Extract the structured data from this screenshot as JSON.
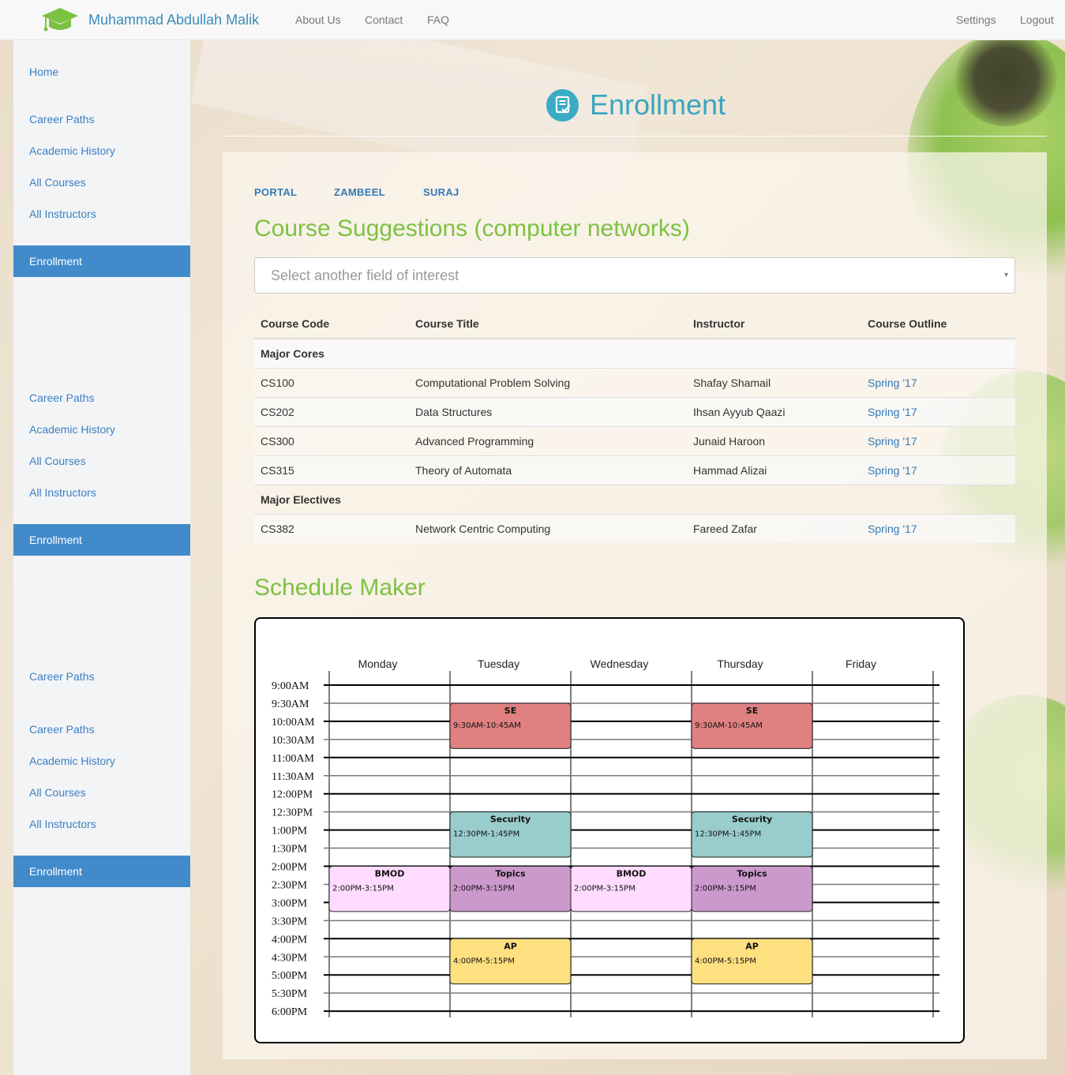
{
  "navbar": {
    "brand": "Muhammad Abdullah Malik",
    "links": [
      "About Us",
      "Contact",
      "FAQ"
    ],
    "right_links": [
      "Settings",
      "Logout"
    ]
  },
  "sidebar": {
    "home": "Home",
    "groups": [
      [
        "Career Paths",
        "Academic History",
        "All Courses",
        "All Instructors",
        "Enrollment"
      ],
      [
        "Career Paths",
        "Academic History",
        "All Courses",
        "All Instructors",
        "Enrollment"
      ],
      [
        "Career Paths"
      ],
      [
        "Career Paths",
        "Academic History",
        "All Courses",
        "All Instructors",
        "Enrollment"
      ]
    ]
  },
  "page": {
    "title": "Enrollment",
    "tabs": [
      "PORTAL",
      "ZAMBEEL",
      "SURAJ"
    ],
    "course_section_title": "Course Suggestions (computer networks)",
    "select_placeholder": "Select another field of interest",
    "schedule_title": "Schedule Maker"
  },
  "table": {
    "headers": [
      "Course Code",
      "Course Title",
      "Instructor",
      "Course Outline"
    ],
    "groups": [
      {
        "name": "Major Cores",
        "rows": [
          [
            "CS100",
            "Computational Problem Solving",
            "Shafay Shamail",
            "Spring '17"
          ],
          [
            "CS202",
            "Data Structures",
            "Ihsan Ayyub Qaazi",
            "Spring '17"
          ],
          [
            "CS300",
            "Advanced Programming",
            "Junaid Haroon",
            "Spring '17"
          ],
          [
            "CS315",
            "Theory of Automata",
            "Hammad Alizai",
            "Spring '17"
          ]
        ]
      },
      {
        "name": "Major Electives",
        "rows": [
          [
            "CS382",
            "Network Centric Computing",
            "Fareed Zafar",
            "Spring '17"
          ]
        ]
      }
    ]
  },
  "schedule": {
    "days": [
      "Monday",
      "Tuesday",
      "Wednesday",
      "Thursday",
      "Friday"
    ],
    "times": [
      "9:00AM",
      "9:30AM",
      "10:00AM",
      "10:30AM",
      "11:00AM",
      "11:30AM",
      "12:00PM",
      "12:30PM",
      "1:00PM",
      "1:30PM",
      "2:00PM",
      "2:30PM",
      "3:00PM",
      "3:30PM",
      "4:00PM",
      "4:30PM",
      "5:00PM",
      "5:30PM",
      "6:00PM"
    ],
    "events": [
      {
        "day": 1,
        "start": 1,
        "end": 3.5,
        "name": "SE",
        "time": "9:30AM-10:45AM",
        "color": "#e08080"
      },
      {
        "day": 3,
        "start": 1,
        "end": 3.5,
        "name": "SE",
        "time": "9:30AM-10:45AM",
        "color": "#e08080"
      },
      {
        "day": 1,
        "start": 7,
        "end": 9.5,
        "name": "Security",
        "time": "12:30PM-1:45PM",
        "color": "#99cccc"
      },
      {
        "day": 3,
        "start": 7,
        "end": 9.5,
        "name": "Security",
        "time": "12:30PM-1:45PM",
        "color": "#99cccc"
      },
      {
        "day": 0,
        "start": 10,
        "end": 12.5,
        "name": "BMOD",
        "time": "2:00PM-3:15PM",
        "color": "#ffdbff"
      },
      {
        "day": 1,
        "start": 10,
        "end": 12.5,
        "name": "Topics",
        "time": "2:00PM-3:15PM",
        "color": "#cc99cc"
      },
      {
        "day": 2,
        "start": 10,
        "end": 12.5,
        "name": "BMOD",
        "time": "2:00PM-3:15PM",
        "color": "#ffdbff"
      },
      {
        "day": 3,
        "start": 10,
        "end": 12.5,
        "name": "Topics",
        "time": "2:00PM-3:15PM",
        "color": "#cc99cc"
      },
      {
        "day": 1,
        "start": 14,
        "end": 16.5,
        "name": "AP",
        "time": "4:00PM-5:15PM",
        "color": "#ffe080"
      },
      {
        "day": 3,
        "start": 14,
        "end": 16.5,
        "name": "AP",
        "time": "4:00PM-5:15PM",
        "color": "#ffe080"
      }
    ]
  },
  "colors": {
    "brand": "#3c8dbc",
    "accent_green": "#7cc242",
    "active_nav": "#428bca",
    "title_teal": "#3aa6c0"
  }
}
